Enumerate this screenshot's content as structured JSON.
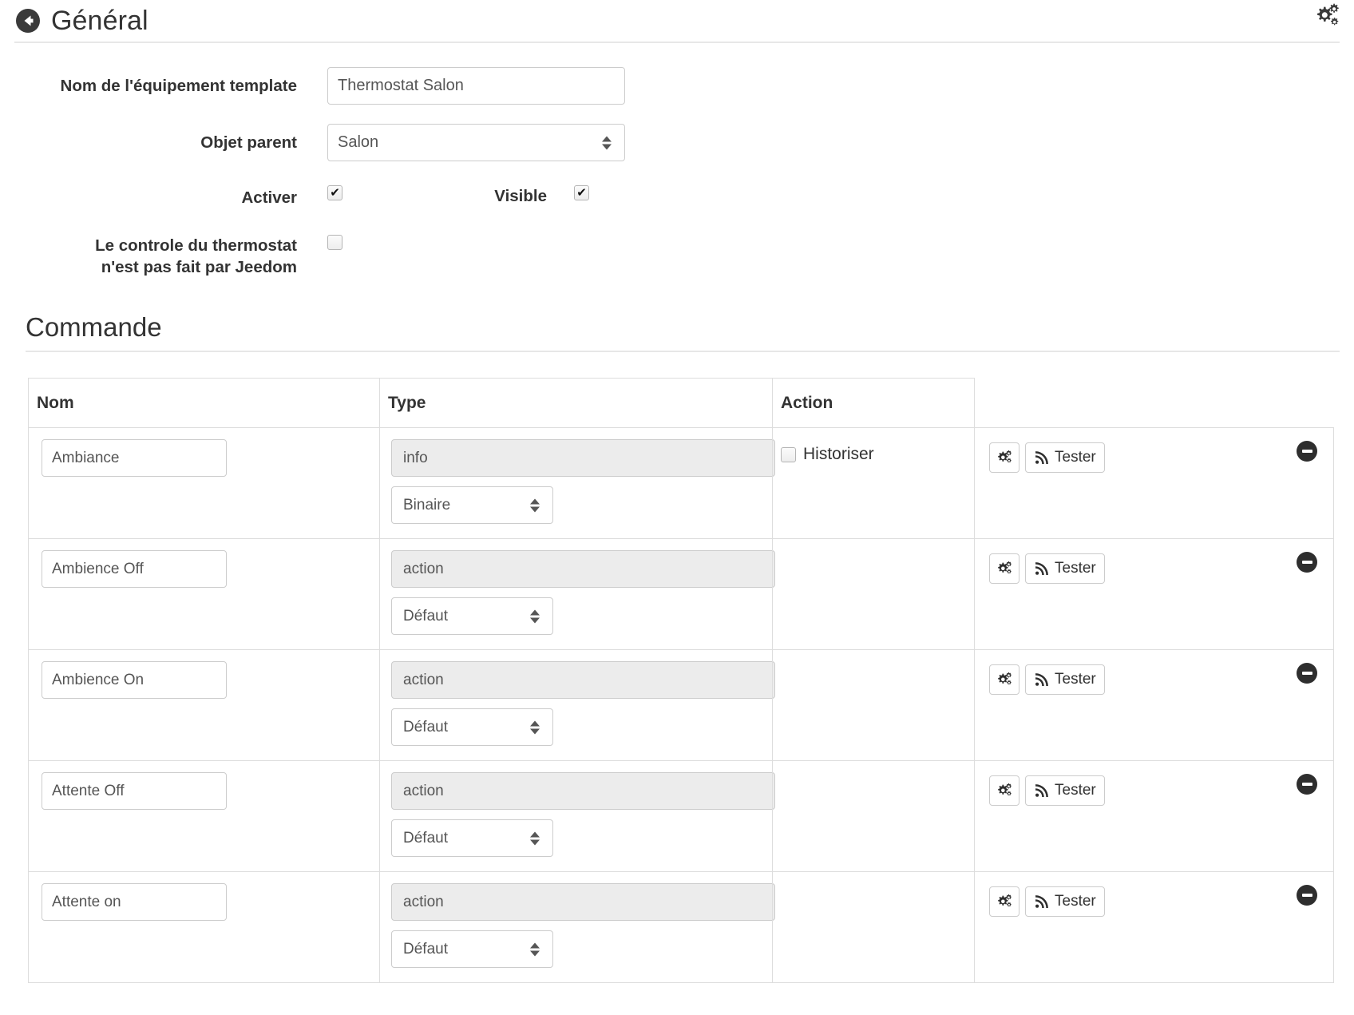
{
  "header": {
    "title": "Général",
    "back_icon": "arrow-circle-left-icon",
    "settings_icon": "cogs-icon"
  },
  "form": {
    "name_label": "Nom de l'équipement template",
    "name_value": "Thermostat Salon",
    "name_placeholder": "Nom de l'équipement template",
    "parent_label": "Objet parent",
    "parent_value": "Salon",
    "activer_label": "Activer",
    "activer_checked": "✔",
    "visible_label": "Visible",
    "visible_checked": "✔",
    "thermostat_label_line1": "Le controle du thermostat",
    "thermostat_label_line2": "n'est pas fait par Jeedom",
    "thermostat_checked": ""
  },
  "commande": {
    "section_title": "Commande",
    "columns": [
      "Nom",
      "Type",
      "Action"
    ],
    "historiser_label": "Historiser",
    "tester_label": "Tester",
    "config_icon": "cogs-icon",
    "tester_icon": "rss-signal-icon",
    "remove_icon": "minus-circle-icon",
    "rows": [
      {
        "name": "Ambiance",
        "type": "info",
        "subtype": "Binaire",
        "has_historiser": true,
        "historiser_checked": false
      },
      {
        "name": "Ambience Off",
        "type": "action",
        "subtype": "Défaut",
        "has_historiser": false,
        "historiser_checked": false
      },
      {
        "name": "Ambience On",
        "type": "action",
        "subtype": "Défaut",
        "has_historiser": false,
        "historiser_checked": false
      },
      {
        "name": "Attente Off",
        "type": "action",
        "subtype": "Défaut",
        "has_historiser": false,
        "historiser_checked": false
      },
      {
        "name": "Attente on",
        "type": "action",
        "subtype": "Défaut",
        "has_historiser": false,
        "historiser_checked": false
      }
    ]
  },
  "colors": {
    "text": "#333333",
    "border": "#cccccc",
    "table_border": "#dddddd",
    "disabled_bg": "#ececec",
    "rule": "#e7e7e7"
  }
}
